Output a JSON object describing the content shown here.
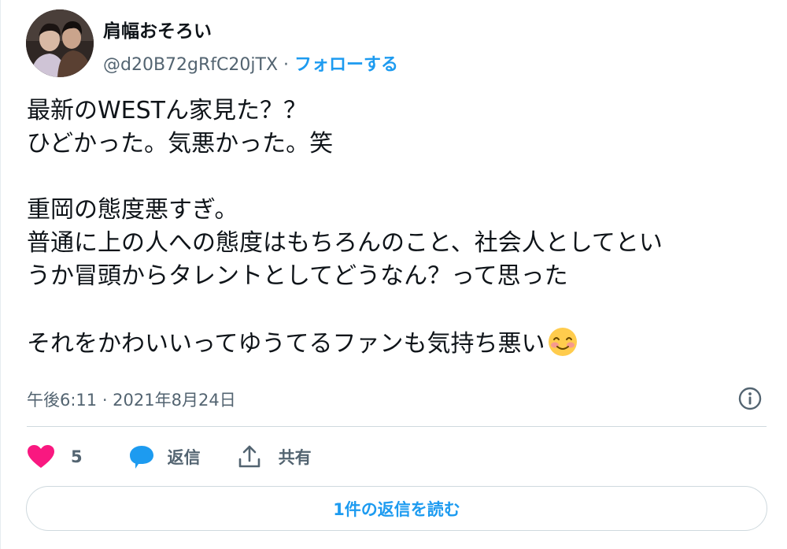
{
  "tweet": {
    "author": {
      "display_name": "肩幅おそろい",
      "handle": "@d20B72gRfC20jTX",
      "separator": "·",
      "follow_label": "フォローする"
    },
    "text_lines": [
      "最新のWESTん家見た？？",
      "ひどかった。気悪かった。笑",
      "",
      "重岡の態度悪すぎ。",
      "普通に上の人への態度はもちろんのこと、社会人としてとい",
      "うか冒頭からタレントとしてどうなん？って思った",
      "",
      "それをかわいいってゆうてるファンも気持ち悪い"
    ],
    "emoji": "smiling-face-with-blush",
    "timestamp": "午後6:11 · 2021年8月24日",
    "like_count": "5",
    "reply_label": "返信",
    "share_label": "共有",
    "read_replies_label": "1件の返信を読む"
  },
  "colors": {
    "accent": "#1d9bf0",
    "like": "#f91880",
    "text": "#0f1419",
    "secondary": "#536471",
    "border": "#cfd9de"
  }
}
